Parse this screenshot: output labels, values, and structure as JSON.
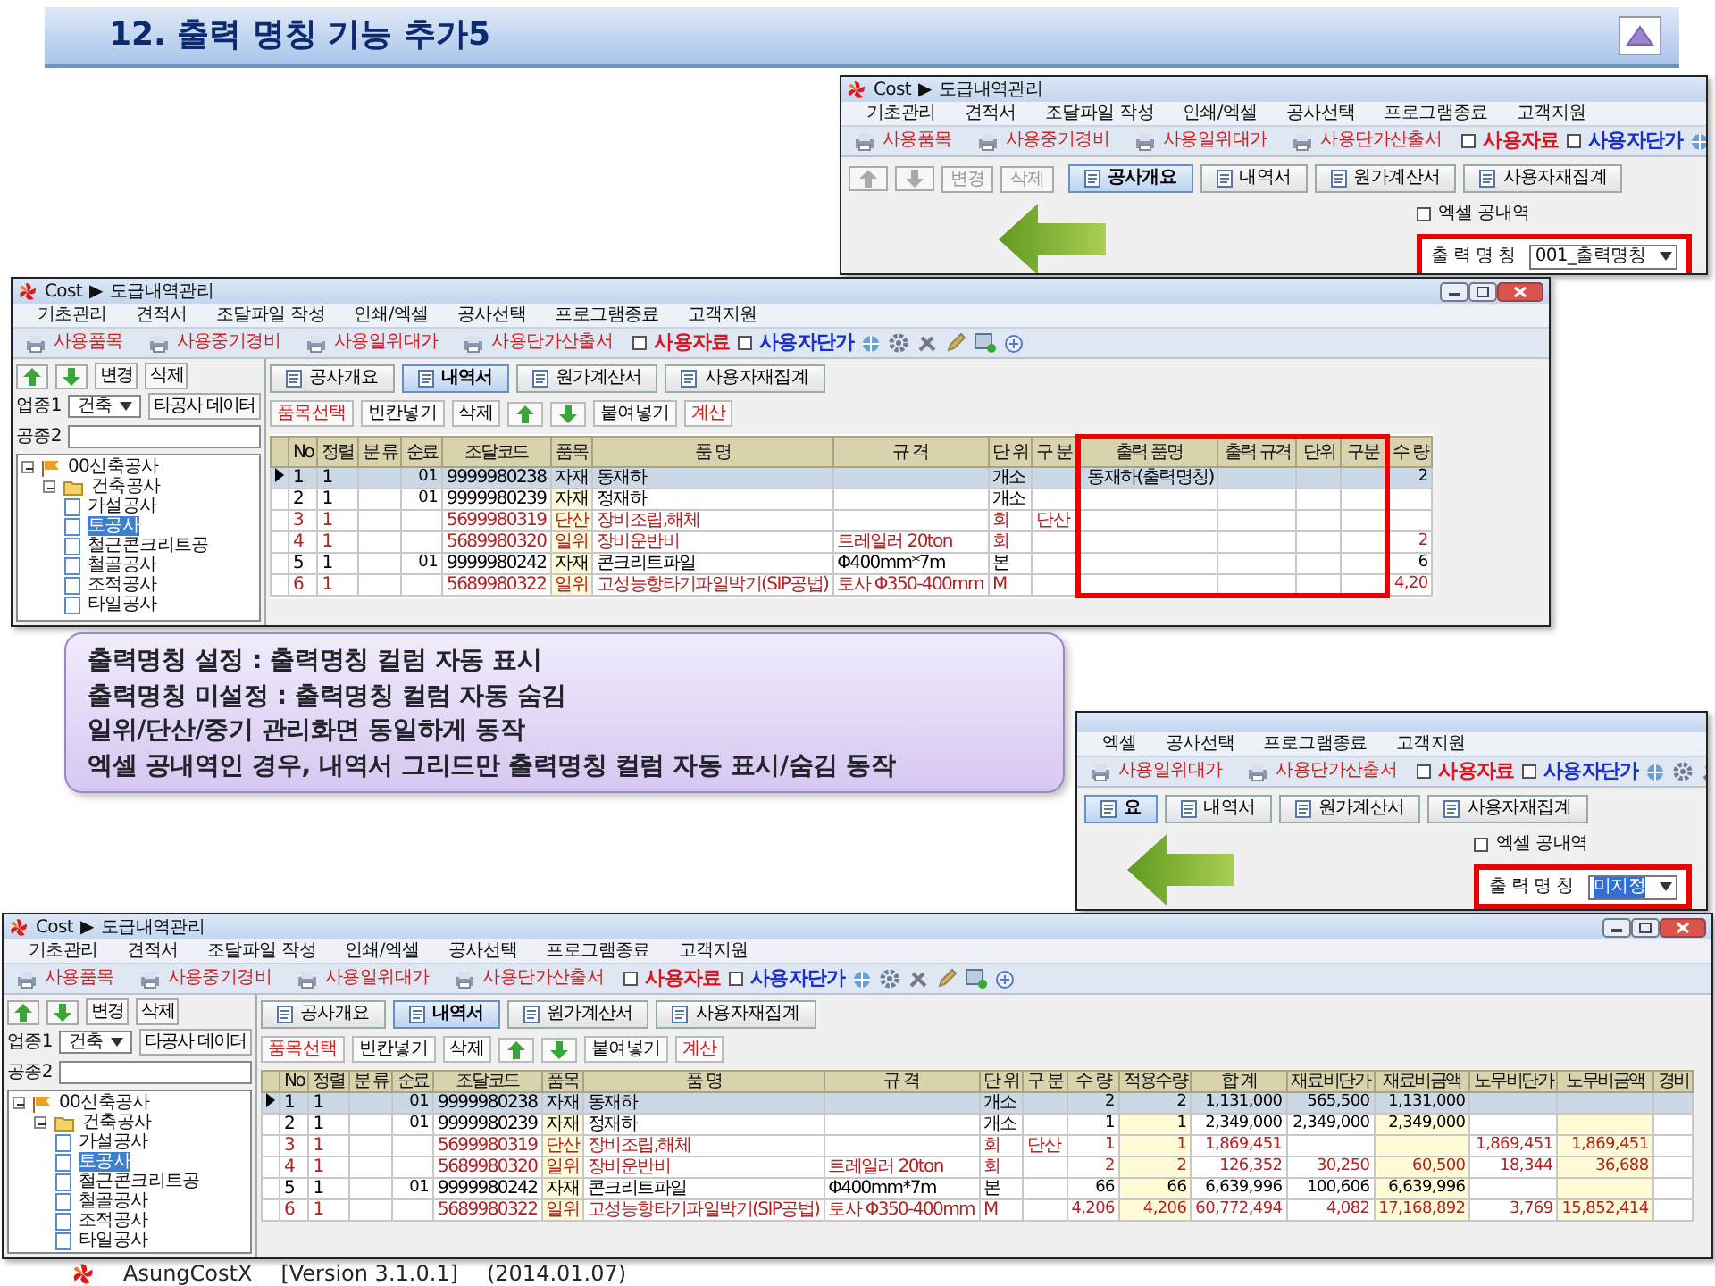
{
  "slide_title": "12. 출력 명칭 기능 추가5",
  "settings_window_top": {
    "kind": "settings",
    "title": {
      "app": "Cost",
      "separator": "▶",
      "path": "도급내역관리"
    },
    "menu": [
      "기초관리",
      "견적서",
      "조달파일 작성",
      "인쇄/엑셀",
      "공사선택",
      "프로그램종료",
      "고객지원"
    ],
    "toolbar": [
      {
        "kind": "button",
        "label": "사용품목"
      },
      {
        "kind": "button",
        "label": "사용중기경비"
      },
      {
        "kind": "button",
        "label": "사용일위대가"
      },
      {
        "kind": "button",
        "label": "사용단가산출서"
      },
      {
        "kind": "check",
        "label": "사용자료",
        "checked": false,
        "color": "#e0141e"
      },
      {
        "kind": "check",
        "label": "사용자단가",
        "checked": false,
        "color": "#1a2fd0"
      }
    ],
    "sidebar_buttons": [
      {
        "kind": "up",
        "disabled": true
      },
      {
        "kind": "down",
        "disabled": true
      },
      {
        "kind": "text",
        "label": "변경",
        "disabled": true
      },
      {
        "kind": "text",
        "label": "삭제",
        "disabled": true
      }
    ],
    "tabs": [
      {
        "label": "공사개요",
        "selected": true
      },
      {
        "label": "내역서",
        "selected": false
      },
      {
        "label": "원가계산서",
        "selected": false
      },
      {
        "label": "사용자재집계",
        "selected": false
      }
    ],
    "settings": {
      "excel_blank": {
        "label": "엑셀 공내역",
        "checked": false
      },
      "output_name": {
        "label": "출 력 명 칭",
        "value": "001_출력명칭",
        "selected": false
      }
    }
  },
  "grid_window_top": {
    "kind": "grid",
    "title": {
      "app": "Cost",
      "separator": "▶",
      "path": "도급내역관리"
    },
    "menu": [
      "기초관리",
      "견적서",
      "조달파일 작성",
      "인쇄/엑셀",
      "공사선택",
      "프로그램종료",
      "고객지원"
    ],
    "toolbar": [
      {
        "kind": "button",
        "label": "사용품목"
      },
      {
        "kind": "button",
        "label": "사용중기경비"
      },
      {
        "kind": "button",
        "label": "사용일위대가"
      },
      {
        "kind": "button",
        "label": "사용단가산출서"
      },
      {
        "kind": "check",
        "label": "사용자료",
        "checked": false,
        "color": "#e0141e"
      },
      {
        "kind": "check",
        "label": "사용자단가",
        "checked": false,
        "color": "#1a2fd0"
      }
    ],
    "sidebar": {
      "buttons": [
        {
          "kind": "up",
          "disabled": false
        },
        {
          "kind": "down",
          "disabled": false
        },
        {
          "kind": "text",
          "label": "변경",
          "disabled": false
        },
        {
          "kind": "text",
          "label": "삭제",
          "disabled": false
        }
      ],
      "trade_label": "업종1",
      "trade_value": "건축",
      "other_button": "타공사 데이터",
      "work_label": "공종2",
      "tree": [
        {
          "label": "00신축공사",
          "kind": "project",
          "expanded": true,
          "selected": false,
          "children": [
            {
              "label": "건축공사",
              "kind": "folder",
              "expanded": true,
              "selected": false,
              "children": [
                {
                  "label": "가설공사",
                  "kind": "page",
                  "selected": false
                },
                {
                  "label": "토공사",
                  "kind": "page",
                  "selected": true
                },
                {
                  "label": "철근콘크리트공",
                  "kind": "page",
                  "selected": false
                },
                {
                  "label": "철골공사",
                  "kind": "page",
                  "selected": false
                },
                {
                  "label": "조적공사",
                  "kind": "page",
                  "selected": false
                },
                {
                  "label": "타일공사",
                  "kind": "page",
                  "selected": false
                }
              ]
            }
          ]
        }
      ]
    },
    "tabs": [
      {
        "label": "공사개요",
        "selected": false
      },
      {
        "label": "내역서",
        "selected": true
      },
      {
        "label": "원가계산서",
        "selected": false
      },
      {
        "label": "사용자재집계",
        "selected": false
      }
    ],
    "grid_toolbar": [
      {
        "kind": "text",
        "label": "품목선택",
        "emphasis": true
      },
      {
        "kind": "text",
        "label": "빈칸넣기",
        "emphasis": false
      },
      {
        "kind": "text",
        "label": "삭제",
        "emphasis": false
      },
      {
        "kind": "up"
      },
      {
        "kind": "down"
      },
      {
        "kind": "text",
        "label": "붙여넣기",
        "emphasis": false
      },
      {
        "kind": "text",
        "label": "계산",
        "emphasis": true
      }
    ],
    "columns": [
      {
        "label": "No",
        "kind": "text",
        "shaded": false,
        "highlighted": false
      },
      {
        "label": "정렬",
        "kind": "text",
        "shaded": false,
        "highlighted": false
      },
      {
        "label": "분 류",
        "kind": "text",
        "shaded": false,
        "highlighted": false
      },
      {
        "label": "순료",
        "kind": "number",
        "shaded": false,
        "highlighted": false
      },
      {
        "label": "조달코드",
        "kind": "text",
        "shaded": false,
        "highlighted": false
      },
      {
        "label": "품목",
        "kind": "text",
        "shaded": true,
        "highlighted": false
      },
      {
        "label": "품 명",
        "kind": "text",
        "shaded": false,
        "highlighted": false
      },
      {
        "label": "규 격",
        "kind": "text",
        "shaded": false,
        "highlighted": false
      },
      {
        "label": "단 위",
        "kind": "text",
        "shaded": false,
        "highlighted": false
      },
      {
        "label": "구 분",
        "kind": "text",
        "shaded": false,
        "highlighted": false
      },
      {
        "label": "출력 품명",
        "kind": "text",
        "shaded": false,
        "highlighted": true
      },
      {
        "label": "출력 규격",
        "kind": "text",
        "shaded": false,
        "highlighted": true
      },
      {
        "label": "단위",
        "kind": "text",
        "shaded": false,
        "highlighted": true
      },
      {
        "label": "구분",
        "kind": "text",
        "shaded": false,
        "highlighted": true
      },
      {
        "label": "수 량",
        "kind": "number",
        "shaded": false,
        "highlighted": false
      }
    ],
    "rows": [
      {
        "selected": true,
        "color": "#000000",
        "cells": [
          "1",
          "1",
          null,
          "01",
          "9999980238",
          "자재",
          "동재하",
          null,
          "개소",
          null,
          "동재하(출력명칭)",
          null,
          null,
          null,
          "2"
        ]
      },
      {
        "selected": false,
        "color": "#000000",
        "cells": [
          "2",
          "1",
          null,
          "01",
          "9999980239",
          "자재",
          "정재하",
          null,
          "개소",
          null,
          null,
          null,
          null,
          null,
          null
        ]
      },
      {
        "selected": false,
        "color": "#b22222",
        "cells": [
          "3",
          "1",
          null,
          null,
          "5699980319",
          "단산",
          "장비조립,해체",
          null,
          "회",
          "단산",
          null,
          null,
          null,
          null,
          null
        ]
      },
      {
        "selected": false,
        "color": "#b22222",
        "cells": [
          "4",
          "1",
          null,
          null,
          "5689980320",
          "일위",
          "장비운반비",
          "트레일러 20ton",
          "회",
          null,
          null,
          null,
          null,
          null,
          "2"
        ]
      },
      {
        "selected": false,
        "color": "#000000",
        "cells": [
          "5",
          "1",
          null,
          "01",
          "9999980242",
          "자재",
          "콘크리트파일",
          "Φ400mm*7m",
          "본",
          null,
          null,
          null,
          null,
          null,
          "6"
        ]
      },
      {
        "selected": false,
        "color": "#b22222",
        "cells": [
          "6",
          "1",
          null,
          null,
          "5689980322",
          "일위",
          "고성능항타기파일박기(SIP공법)",
          "토사 Φ350-400mm",
          "M",
          null,
          null,
          null,
          null,
          null,
          "4,20"
        ]
      }
    ]
  },
  "callout": [
    "출력명칭 설정    : 출력명칭 컬럼 자동 표시",
    "출력명칭 미설정 : 출력명칭 컬럼 자동 숨김",
    "일위/단산/중기 관리화면 동일하게 동작",
    "엑셀 공내역인 경우, 내역서 그리드만 출력명칭 컬럼 자동 표시/숨김 동작"
  ],
  "settings_window_bottom": {
    "kind": "settings",
    "menu": [
      "엑셀",
      "공사선택",
      "프로그램종료",
      "고객지원"
    ],
    "toolbar": [
      {
        "kind": "button",
        "label": "사용일위대가"
      },
      {
        "kind": "button",
        "label": "사용단가산출서"
      },
      {
        "kind": "check",
        "label": "사용자료",
        "checked": false,
        "color": "#e0141e"
      },
      {
        "kind": "check",
        "label": "사용자단가",
        "checked": false,
        "color": "#1a2fd0"
      }
    ],
    "tabs": [
      {
        "label": "요",
        "selected": true
      },
      {
        "label": "내역서",
        "selected": false
      },
      {
        "label": "원가계산서",
        "selected": false
      },
      {
        "label": "사용자재집계",
        "selected": false
      }
    ],
    "settings": {
      "excel_blank": {
        "label": "엑셀 공내역",
        "checked": false
      },
      "output_name": {
        "label": "출 력 명 칭",
        "value": "미지정",
        "selected": true
      }
    }
  },
  "grid_window_bottom": {
    "kind": "grid",
    "title": {
      "app": "Cost",
      "separator": "▶",
      "path": "도급내역관리"
    },
    "menu": [
      "기초관리",
      "견적서",
      "조달파일 작성",
      "인쇄/엑셀",
      "공사선택",
      "프로그램종료",
      "고객지원"
    ],
    "toolbar": [
      {
        "kind": "button",
        "label": "사용품목"
      },
      {
        "kind": "button",
        "label": "사용중기경비"
      },
      {
        "kind": "button",
        "label": "사용일위대가"
      },
      {
        "kind": "button",
        "label": "사용단가산출서"
      },
      {
        "kind": "check",
        "label": "사용자료",
        "checked": false,
        "color": "#e0141e"
      },
      {
        "kind": "check",
        "label": "사용자단가",
        "checked": false,
        "color": "#1a2fd0"
      }
    ],
    "sidebar": {
      "buttons": [
        {
          "kind": "up",
          "disabled": false
        },
        {
          "kind": "down",
          "disabled": false
        },
        {
          "kind": "text",
          "label": "변경",
          "disabled": false
        },
        {
          "kind": "text",
          "label": "삭제",
          "disabled": false
        }
      ],
      "trade_label": "업종1",
      "trade_value": "건축",
      "other_button": "타공사 데이터",
      "work_label": "공종2",
      "tree": [
        {
          "label": "00신축공사",
          "kind": "project",
          "expanded": true,
          "selected": false,
          "children": [
            {
              "label": "건축공사",
              "kind": "folder",
              "expanded": true,
              "selected": false,
              "children": [
                {
                  "label": "가설공사",
                  "kind": "page",
                  "selected": false
                },
                {
                  "label": "토공사",
                  "kind": "page",
                  "selected": true
                },
                {
                  "label": "철근콘크리트공",
                  "kind": "page",
                  "selected": false
                },
                {
                  "label": "철골공사",
                  "kind": "page",
                  "selected": false
                },
                {
                  "label": "조적공사",
                  "kind": "page",
                  "selected": false
                },
                {
                  "label": "타일공사",
                  "kind": "page",
                  "selected": false
                }
              ]
            }
          ]
        }
      ]
    },
    "tabs": [
      {
        "label": "공사개요",
        "selected": false
      },
      {
        "label": "내역서",
        "selected": true
      },
      {
        "label": "원가계산서",
        "selected": false
      },
      {
        "label": "사용자재집계",
        "selected": false
      }
    ],
    "grid_toolbar": [
      {
        "kind": "text",
        "label": "품목선택",
        "emphasis": true
      },
      {
        "kind": "text",
        "label": "빈칸넣기",
        "emphasis": false
      },
      {
        "kind": "text",
        "label": "삭제",
        "emphasis": false
      },
      {
        "kind": "up"
      },
      {
        "kind": "down"
      },
      {
        "kind": "text",
        "label": "붙여넣기",
        "emphasis": false
      },
      {
        "kind": "text",
        "label": "계산",
        "emphasis": true
      }
    ],
    "columns": [
      {
        "label": "No",
        "kind": "text",
        "shaded": false,
        "highlighted": false
      },
      {
        "label": "정렬",
        "kind": "text",
        "shaded": false,
        "highlighted": false
      },
      {
        "label": "분 류",
        "kind": "text",
        "shaded": false,
        "highlighted": false
      },
      {
        "label": "순료",
        "kind": "number",
        "shaded": false,
        "highlighted": false
      },
      {
        "label": "조달코드",
        "kind": "text",
        "shaded": false,
        "highlighted": false
      },
      {
        "label": "품목",
        "kind": "text",
        "shaded": true,
        "highlighted": false
      },
      {
        "label": "품 명",
        "kind": "text",
        "shaded": false,
        "highlighted": false
      },
      {
        "label": "규 격",
        "kind": "text",
        "shaded": false,
        "highlighted": false
      },
      {
        "label": "단 위",
        "kind": "text",
        "shaded": false,
        "highlighted": false
      },
      {
        "label": "구 분",
        "kind": "text",
        "shaded": false,
        "highlighted": false
      },
      {
        "label": "수 량",
        "kind": "number",
        "shaded": false,
        "highlighted": false
      },
      {
        "label": "적용수량",
        "kind": "number",
        "shaded": true,
        "highlighted": false
      },
      {
        "label": "합 계",
        "kind": "number",
        "shaded": false,
        "highlighted": false
      },
      {
        "label": "재료비단가",
        "kind": "number",
        "shaded": false,
        "highlighted": false
      },
      {
        "label": "재료비금액",
        "kind": "number",
        "shaded": true,
        "highlighted": false
      },
      {
        "label": "노무비단가",
        "kind": "number",
        "shaded": false,
        "highlighted": false
      },
      {
        "label": "노무비금액",
        "kind": "number",
        "shaded": true,
        "highlighted": false
      },
      {
        "label": "경비",
        "kind": "number",
        "shaded": false,
        "highlighted": false
      }
    ],
    "rows": [
      {
        "selected": true,
        "color": "#000000",
        "cells": [
          "1",
          "1",
          null,
          "01",
          "9999980238",
          "자재",
          "동재하",
          null,
          "개소",
          null,
          "2",
          "2",
          "1,131,000",
          "565,500",
          "1,131,000",
          null,
          null,
          null
        ]
      },
      {
        "selected": false,
        "color": "#000000",
        "cells": [
          "2",
          "1",
          null,
          "01",
          "9999980239",
          "자재",
          "정재하",
          null,
          "개소",
          null,
          "1",
          "1",
          "2,349,000",
          "2,349,000",
          "2,349,000",
          null,
          null,
          null
        ]
      },
      {
        "selected": false,
        "color": "#b22222",
        "cells": [
          "3",
          "1",
          null,
          null,
          "5699980319",
          "단산",
          "장비조립,해체",
          null,
          "회",
          "단산",
          "1",
          "1",
          "1,869,451",
          null,
          null,
          "1,869,451",
          "1,869,451",
          null
        ]
      },
      {
        "selected": false,
        "color": "#b22222",
        "cells": [
          "4",
          "1",
          null,
          null,
          "5689980320",
          "일위",
          "장비운반비",
          "트레일러 20ton",
          "회",
          null,
          "2",
          "2",
          "126,352",
          "30,250",
          "60,500",
          "18,344",
          "36,688",
          null
        ]
      },
      {
        "selected": false,
        "color": "#000000",
        "cells": [
          "5",
          "1",
          null,
          "01",
          "9999980242",
          "자재",
          "콘크리트파일",
          "Φ400mm*7m",
          "본",
          null,
          "66",
          "66",
          "6,639,996",
          "100,606",
          "6,639,996",
          null,
          null,
          null
        ]
      },
      {
        "selected": false,
        "color": "#b22222",
        "cells": [
          "6",
          "1",
          null,
          null,
          "5689980322",
          "일위",
          "고성능항타기파일박기(SIP공법)",
          "토사 Φ350-400mm",
          "M",
          null,
          "4,206",
          "4,206",
          "60,772,494",
          "4,082",
          "17,168,892",
          "3,769",
          "15,852,414",
          null
        ]
      }
    ]
  },
  "footer": {
    "product": "AsungCostX",
    "version": "[Version 3.1.0.1]",
    "date": "(2014.01.07)"
  }
}
